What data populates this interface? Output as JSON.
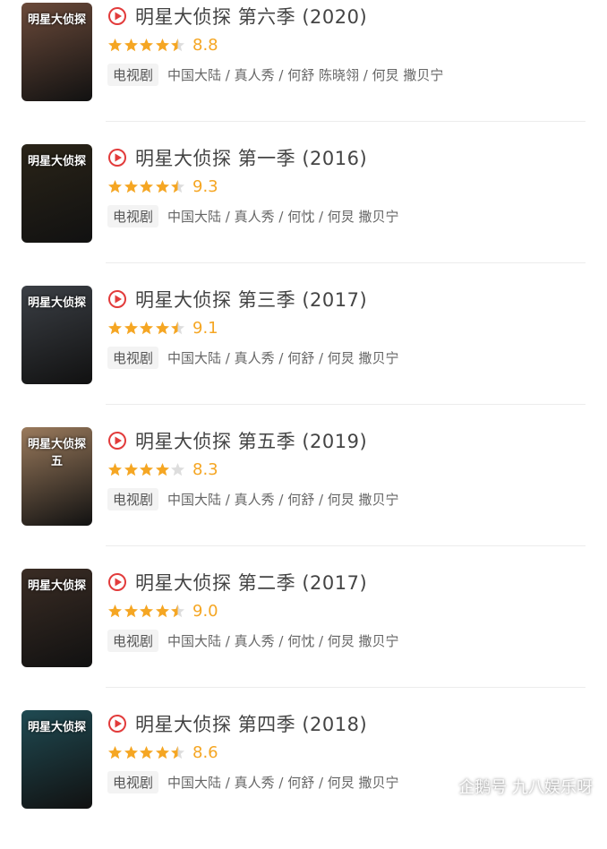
{
  "items": [
    {
      "title": "明星大侦探 第六季 (2020)",
      "score": "8.8",
      "stars": [
        1,
        1,
        1,
        1,
        0.5
      ],
      "tag": "电视剧",
      "meta": "中国大陆 / 真人秀 / 何舒 陈晓翎 / 何炅 撒贝宁",
      "poster_text": "明星大侦探",
      "poster_bg": "#6b4a3a"
    },
    {
      "title": "明星大侦探 第一季 (2016)",
      "score": "9.3",
      "stars": [
        1,
        1,
        1,
        1,
        0.5
      ],
      "tag": "电视剧",
      "meta": "中国大陆 / 真人秀 / 何忱 / 何炅 撒贝宁",
      "poster_text": "明星大侦探",
      "poster_bg": "#2a2418"
    },
    {
      "title": "明星大侦探 第三季 (2017)",
      "score": "9.1",
      "stars": [
        1,
        1,
        1,
        1,
        0.5
      ],
      "tag": "电视剧",
      "meta": "中国大陆 / 真人秀 / 何舒 / 何炅 撒贝宁",
      "poster_text": "明星大侦探",
      "poster_bg": "#3b3f45"
    },
    {
      "title": "明星大侦探 第五季 (2019)",
      "score": "8.3",
      "stars": [
        1,
        1,
        1,
        1,
        0
      ],
      "tag": "电视剧",
      "meta": "中国大陆 / 真人秀 / 何舒 / 何炅 撒贝宁",
      "poster_text": "明星大侦探 五",
      "poster_bg": "#9a7a5c"
    },
    {
      "title": "明星大侦探 第二季 (2017)",
      "score": "9.0",
      "stars": [
        1,
        1,
        1,
        1,
        0.5
      ],
      "tag": "电视剧",
      "meta": "中国大陆 / 真人秀 / 何忱 / 何炅 撒贝宁",
      "poster_text": "明星大侦探",
      "poster_bg": "#3a2c24"
    },
    {
      "title": "明星大侦探 第四季 (2018)",
      "score": "8.6",
      "stars": [
        1,
        1,
        1,
        1,
        0.5
      ],
      "tag": "电视剧",
      "meta": "中国大陆 / 真人秀 / 何舒 / 何炅 撒贝宁",
      "poster_text": "明星大侦探",
      "poster_bg": "#1f4a52"
    }
  ],
  "watermark": "企鹅号 九八娱乐呀",
  "colors": {
    "star": "#f5a623",
    "star_empty": "#dddddd",
    "play_icon": "#e23b3b"
  }
}
